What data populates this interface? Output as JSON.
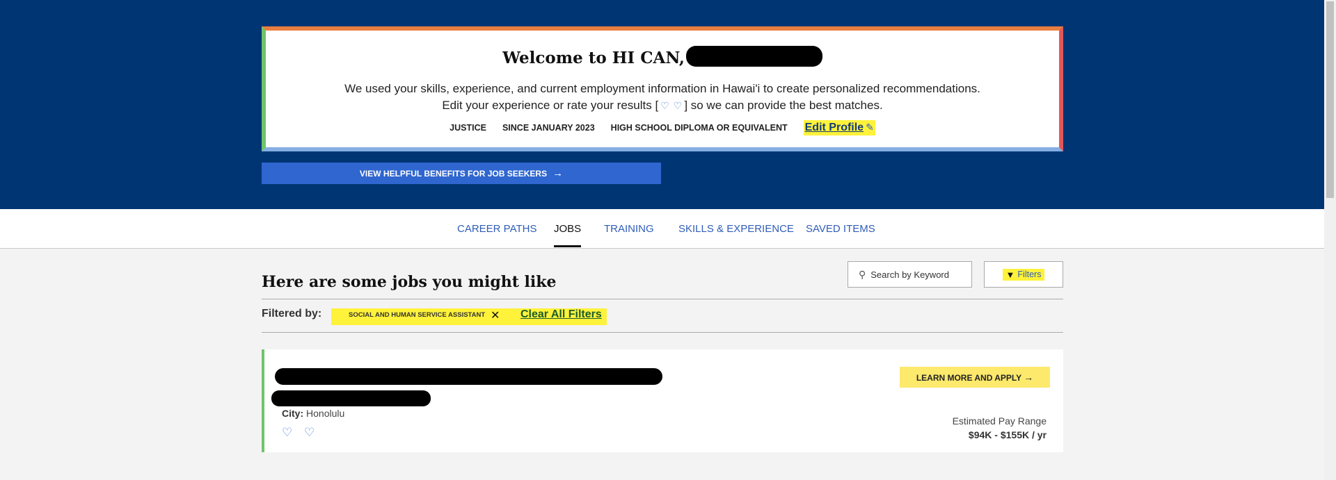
{
  "welcome": {
    "title": "Welcome to HI CAN,",
    "subtitle_line1": "We used your skills, experience, and current employment information in Hawai'i to create personalized recommendations.",
    "subtitle_line2_pre": "Edit your experience or rate your results [",
    "subtitle_line2_post": "] so we can provide the best matches.",
    "meta": [
      "JUSTICE",
      "SINCE JANUARY 2023",
      "HIGH SCHOOL DIPLOMA OR EQUIVALENT"
    ],
    "edit_profile": "Edit Profile"
  },
  "benefits_button": "VIEW HELPFUL BENEFITS FOR JOB SEEKERS",
  "tabs": [
    {
      "label": "CAREER PATHS",
      "active": false
    },
    {
      "label": "JOBS",
      "active": true
    },
    {
      "label": "TRAINING",
      "active": false
    },
    {
      "label": "SKILLS & EXPERIENCE",
      "active": false
    },
    {
      "label": "SAVED ITEMS",
      "active": false
    }
  ],
  "jobs": {
    "title": "Here are some jobs you might like",
    "search_placeholder": "Search by Keyword",
    "filters_label": "Filters",
    "filtered_by_label": "Filtered by:",
    "active_filter": "SOCIAL AND HUMAN SERVICE ASSISTANT",
    "clear_filters": "Clear All Filters"
  },
  "job_card": {
    "city_label": "City:",
    "city": "Honolulu",
    "learn_more": "LEARN MORE AND APPLY",
    "pay_label": "Estimated Pay Range",
    "pay_value": "$94K - $155K / yr"
  },
  "icons": {
    "heart": "♡",
    "arrow": "→",
    "pencil": "✎",
    "close": "✕",
    "search": "⚲",
    "funnel": "▼"
  },
  "colors": {
    "hero_bg": "#003573",
    "accent_blue": "#2f66cf",
    "highlight": "#fff23a",
    "cta_yellow": "#fde96c"
  }
}
